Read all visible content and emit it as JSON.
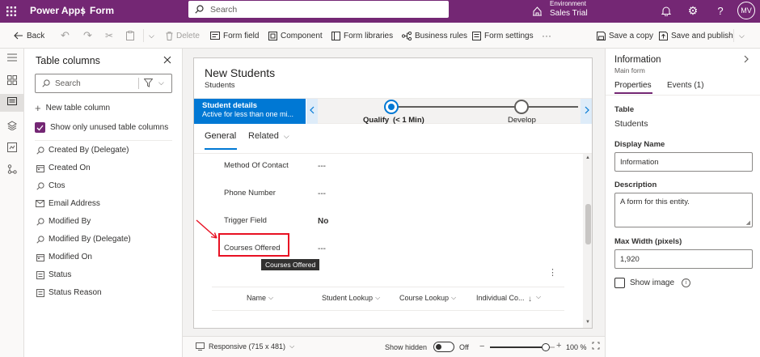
{
  "topbar": {
    "app_name": "Power Apps",
    "separator": "|",
    "section": "Form",
    "search_placeholder": "Search",
    "env_label": "Environment",
    "env_name": "Sales Trial",
    "avatar_initials": "MV"
  },
  "commandbar": {
    "back": "Back",
    "delete": "Delete",
    "form_field": "Form field",
    "component": "Component",
    "form_libraries": "Form libraries",
    "business_rules": "Business rules",
    "form_settings": "Form settings",
    "more": "···",
    "save_copy": "Save a copy",
    "save_publish": "Save and publish"
  },
  "left_panel": {
    "title": "Table columns",
    "search_placeholder": "Search",
    "new_column": "New table column",
    "show_unused": "Show only unused table columns",
    "columns": [
      {
        "label": "Created By (Delegate)",
        "icon": "lookup-icon"
      },
      {
        "label": "Created On",
        "icon": "calendar-icon"
      },
      {
        "label": "Ctos",
        "icon": "lookup-icon"
      },
      {
        "label": "Email Address",
        "icon": "email-icon"
      },
      {
        "label": "Modified By",
        "icon": "lookup-icon"
      },
      {
        "label": "Modified By (Delegate)",
        "icon": "lookup-icon"
      },
      {
        "label": "Modified On",
        "icon": "calendar-icon"
      },
      {
        "label": "Status",
        "icon": "option-set-icon"
      },
      {
        "label": "Status Reason",
        "icon": "option-set-icon"
      }
    ]
  },
  "form": {
    "title": "New Students",
    "subtitle": "Students",
    "bpf": {
      "active_stage": "Student details",
      "active_sub": "Active for less than one mi...",
      "stage1": "Qualify",
      "stage1_time": "(< 1 Min)",
      "stage2": "Develop"
    },
    "tabs": [
      "General",
      "Related"
    ],
    "fields": [
      {
        "label": "Method Of Contact",
        "value": "---"
      },
      {
        "label": "Phone Number",
        "value": "---"
      },
      {
        "label": "Trigger Field",
        "value": "No"
      },
      {
        "label": "Courses Offered",
        "value": "---"
      }
    ],
    "tooltip": "Courses Offered",
    "grid_columns": [
      "Name",
      "Student Lookup",
      "Course Lookup",
      "Individual Co..."
    ]
  },
  "bottombar": {
    "responsive": "Responsive (715 x 481)",
    "show_hidden": "Show hidden",
    "toggle_state": "Off",
    "zoom": "100 %",
    "zoom_value": 100
  },
  "right_panel": {
    "title": "Information",
    "subtitle": "Main form",
    "tab_properties": "Properties",
    "tab_events": "Events (1)",
    "table_label": "Table",
    "table_value": "Students",
    "display_name_label": "Display Name",
    "display_name_value": "Information",
    "description_label": "Description",
    "description_value": "A form for this entity.",
    "max_width_label": "Max Width (pixels)",
    "max_width_value": "1,920",
    "show_image": "Show image"
  },
  "colors": {
    "brand": "#742774",
    "accent": "#0078d4",
    "annotation_red": "#e81123"
  }
}
